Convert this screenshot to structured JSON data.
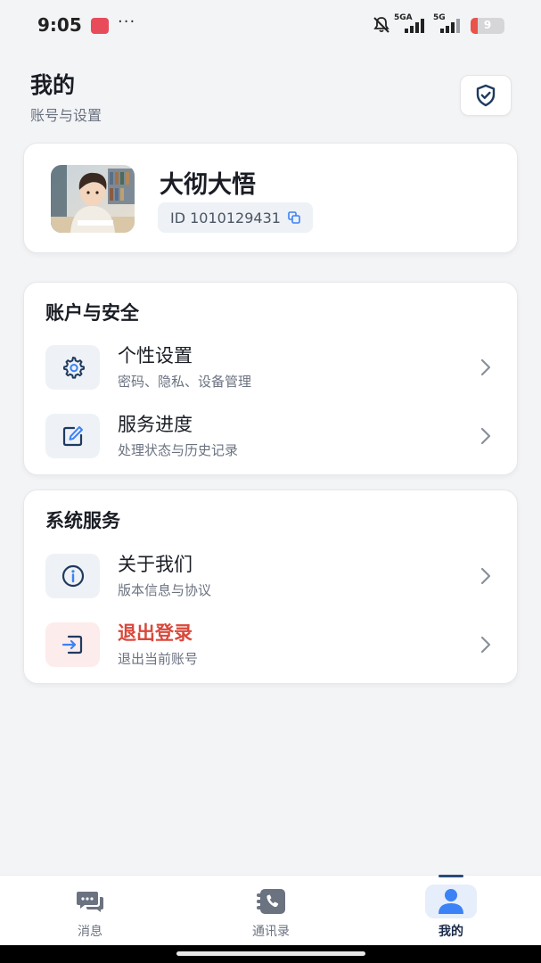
{
  "status_bar": {
    "time": "9:05",
    "more": "···",
    "signal1_label": "5GA",
    "signal2_label": "5G",
    "battery": "9"
  },
  "header": {
    "title": "我的",
    "subtitle": "账号与设置"
  },
  "profile": {
    "name": "大彻大悟",
    "id_text": "ID 1010129431"
  },
  "section_account": {
    "title": "账户与安全",
    "items": [
      {
        "title": "个性设置",
        "subtitle": "密码、隐私、设备管理",
        "icon": "gear-icon"
      },
      {
        "title": "服务进度",
        "subtitle": "处理状态与历史记录",
        "icon": "edit-icon"
      }
    ]
  },
  "section_system": {
    "title": "系统服务",
    "items": [
      {
        "title": "关于我们",
        "subtitle": "版本信息与协议",
        "icon": "info-icon"
      },
      {
        "title": "退出登录",
        "subtitle": "退出当前账号",
        "icon": "logout-icon"
      }
    ]
  },
  "bottom_nav": {
    "items": [
      {
        "label": "消息",
        "icon": "chat-icon"
      },
      {
        "label": "通讯录",
        "icon": "contacts-icon"
      },
      {
        "label": "我的",
        "icon": "user-icon",
        "active": true
      }
    ]
  },
  "colors": {
    "danger": "#d9483b",
    "icon_blue": "#1f3a5f",
    "active_nav": "#3b82f6"
  }
}
